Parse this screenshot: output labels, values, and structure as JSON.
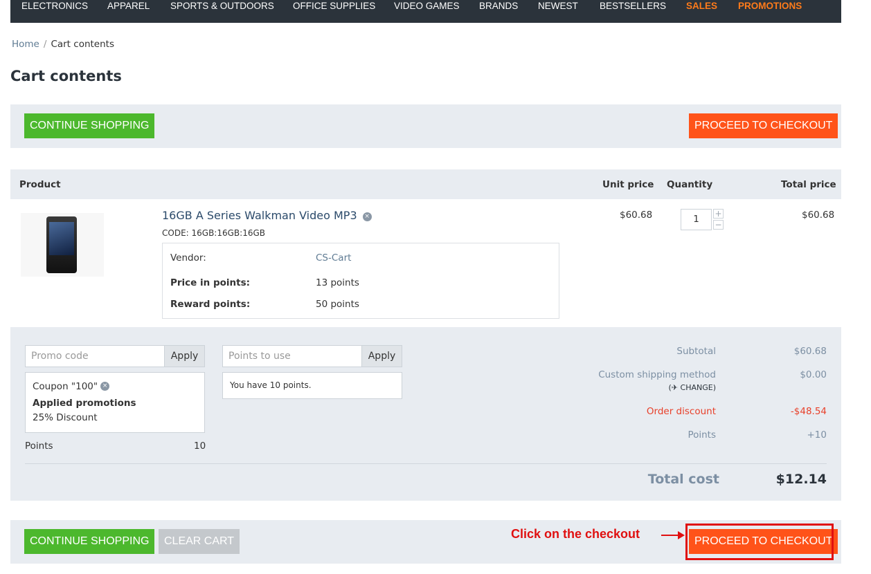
{
  "nav": {
    "items": [
      "ELECTRONICS",
      "APPAREL",
      "SPORTS & OUTDOORS",
      "OFFICE SUPPLIES",
      "VIDEO GAMES",
      "BRANDS",
      "NEWEST",
      "BESTSELLERS"
    ],
    "hot_items": [
      "SALES",
      "PROMOTIONS"
    ]
  },
  "breadcrumb": {
    "home": "Home",
    "separator": "/",
    "current": "Cart contents"
  },
  "page_title": "Cart contents",
  "top_buttons": {
    "continue": "CONTINUE SHOPPING",
    "checkout": "PROCEED TO CHECKOUT"
  },
  "table": {
    "headers": {
      "product": "Product",
      "unit_price": "Unit price",
      "quantity": "Quantity",
      "total_price": "Total price"
    },
    "product": {
      "name": "16GB A Series Walkman Video MP3",
      "remove_icon": "×",
      "code": "CODE: 16GB:16GB:16GB",
      "vendor_label": "Vendor:",
      "vendor_value": "CS-Cart",
      "price_points_label": "Price in points:",
      "price_points_value": "13 points",
      "reward_label": "Reward points:",
      "reward_value": "50 points",
      "unit_price": "$60.68",
      "quantity": "1",
      "qty_plus": "+",
      "qty_minus": "−",
      "total_price": "$60.68"
    }
  },
  "promo": {
    "placeholder": "Promo code",
    "apply": "Apply",
    "coupon": "Coupon \"100\"",
    "applied_title": "Applied promotions",
    "discount": "25% Discount",
    "points_label": "Points",
    "points_value": "10"
  },
  "points_use": {
    "placeholder": "Points to use",
    "apply": "Apply",
    "note": "You have 10 points."
  },
  "summary": {
    "subtotal_label": "Subtotal",
    "subtotal_value": "$60.68",
    "shipping_label": "Custom shipping method",
    "shipping_change": "(✈ CHANGE)",
    "shipping_value": "$0.00",
    "discount_label": "Order discount",
    "discount_value": "-$48.54",
    "points_label": "Points",
    "points_value": "+10",
    "total_label": "Total cost",
    "total_value": "$12.14"
  },
  "bottom_buttons": {
    "continue": "CONTINUE SHOPPING",
    "clear": "CLEAR CART",
    "checkout": "PROCEED TO CHECKOUT"
  },
  "annotation": {
    "text": "Click on the checkout"
  },
  "colors": {
    "nav_bg": "#2b333b",
    "green": "#4cb82d",
    "orange": "#ff5319",
    "hot": "#ff7b1a",
    "panel": "#e8ecf1",
    "annotation": "#e01010"
  }
}
